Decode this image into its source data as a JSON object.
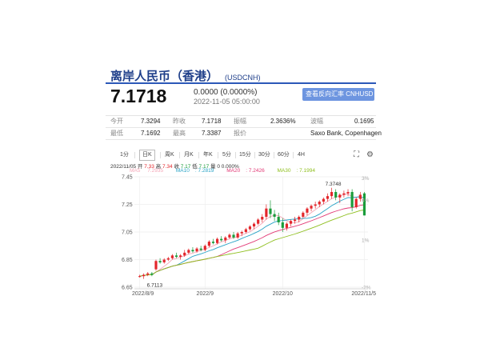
{
  "header": {
    "title": "离岸人民币（香港）",
    "code": "(USDCNH)",
    "price": "7.1718",
    "change": "0.0000 (0.0000%)",
    "timestamp": "2022-11-05 05:00:00",
    "reverse_button": "查看反向汇率 CNHUSD"
  },
  "stats": [
    [
      {
        "label": "今开",
        "value": "7.3294"
      },
      {
        "label": "昨收",
        "value": "7.1718"
      },
      {
        "label": "振幅",
        "value": "2.3636%"
      },
      {
        "label": "波幅",
        "value": "0.1695"
      }
    ],
    [
      {
        "label": "最低",
        "value": "7.1692"
      },
      {
        "label": "最高",
        "value": "7.3387"
      },
      {
        "label": "报价",
        "value": "Saxo Bank, Copenhagen"
      }
    ]
  ],
  "tabs": [
    "1分",
    "日K",
    "周K",
    "月K",
    "年K",
    "5分",
    "15分",
    "30分",
    "60分",
    "4H"
  ],
  "active_tab": "日K",
  "quote_line": {
    "date": "2022/11/05",
    "open_label": "开",
    "open": "7.33",
    "high_label": "高",
    "high": "7.34",
    "low_label": "收",
    "low": "7.17",
    "close_label": "低",
    "close": "7.17",
    "volume_label": "量",
    "volume": "0",
    "pct": "0.000%"
  },
  "ma": [
    {
      "label": "MA5",
      "value": "7.2935",
      "color": "#f5a7b8"
    },
    {
      "label": "MA10",
      "value": "7.2819",
      "color": "#29a3c6"
    },
    {
      "label": "MA20",
      "value": "7.2426",
      "color": "#e23a76"
    },
    {
      "label": "MA30",
      "value": "7.1994",
      "color": "#8fbf1f"
    }
  ],
  "colors": {
    "up": "#e3262b",
    "down": "#1a9c3b",
    "accent": "#2b58b8"
  },
  "chart_data": {
    "type": "candlestick",
    "y_ticks": [
      "7.45",
      "7.25",
      "7.05",
      "6.85",
      "6.65"
    ],
    "pct_ticks": [
      "3%",
      "4%",
      "1%",
      "-2%"
    ],
    "x_ticks": [
      "2022/8/9",
      "2022/9",
      "2022/10",
      "2022/11/5"
    ],
    "ylim": [
      6.65,
      7.45
    ],
    "annotations": {
      "max": "7.3748",
      "min": "6.7113"
    },
    "candles": [
      [
        6.73,
        6.74,
        6.72,
        6.73
      ],
      [
        6.73,
        6.75,
        6.71,
        6.74
      ],
      [
        6.74,
        6.76,
        6.73,
        6.75
      ],
      [
        6.75,
        6.76,
        6.73,
        6.74
      ],
      [
        6.78,
        6.85,
        6.77,
        6.84
      ],
      [
        6.84,
        6.86,
        6.82,
        6.83
      ],
      [
        6.83,
        6.86,
        6.82,
        6.85
      ],
      [
        6.85,
        6.87,
        6.84,
        6.86
      ],
      [
        6.86,
        6.89,
        6.85,
        6.88
      ],
      [
        6.88,
        6.9,
        6.86,
        6.87
      ],
      [
        6.87,
        6.89,
        6.85,
        6.88
      ],
      [
        6.88,
        6.92,
        6.87,
        6.9
      ],
      [
        6.9,
        6.93,
        6.89,
        6.92
      ],
      [
        6.92,
        6.94,
        6.9,
        6.91
      ],
      [
        6.91,
        6.94,
        6.9,
        6.93
      ],
      [
        6.93,
        6.95,
        6.91,
        6.92
      ],
      [
        6.92,
        6.96,
        6.91,
        6.95
      ],
      [
        6.95,
        6.99,
        6.94,
        6.98
      ],
      [
        6.98,
        7.0,
        6.96,
        6.97
      ],
      [
        6.97,
        7.01,
        6.96,
        7.0
      ],
      [
        7.0,
        7.02,
        6.98,
        6.99
      ],
      [
        6.99,
        7.02,
        6.97,
        7.01
      ],
      [
        7.01,
        7.04,
        7.0,
        7.03
      ],
      [
        7.03,
        7.05,
        7.0,
        7.01
      ],
      [
        7.01,
        7.05,
        7.0,
        7.04
      ],
      [
        7.04,
        7.06,
        7.02,
        7.05
      ],
      [
        7.05,
        7.08,
        7.04,
        7.07
      ],
      [
        7.07,
        7.1,
        7.06,
        7.09
      ],
      [
        7.09,
        7.12,
        7.07,
        7.11
      ],
      [
        7.11,
        7.15,
        7.1,
        7.14
      ],
      [
        7.14,
        7.18,
        7.12,
        7.16
      ],
      [
        7.16,
        7.25,
        7.14,
        7.22
      ],
      [
        7.22,
        7.28,
        7.15,
        7.18
      ],
      [
        7.18,
        7.21,
        7.13,
        7.16
      ],
      [
        7.16,
        7.19,
        7.1,
        7.12
      ],
      [
        7.12,
        7.15,
        7.05,
        7.08
      ],
      [
        7.08,
        7.12,
        7.06,
        7.11
      ],
      [
        7.11,
        7.14,
        7.09,
        7.13
      ],
      [
        7.13,
        7.16,
        7.11,
        7.14
      ],
      [
        7.14,
        7.17,
        7.12,
        7.16
      ],
      [
        7.16,
        7.2,
        7.15,
        7.19
      ],
      [
        7.19,
        7.23,
        7.17,
        7.22
      ],
      [
        7.22,
        7.25,
        7.2,
        7.24
      ],
      [
        7.24,
        7.27,
        7.22,
        7.25
      ],
      [
        7.25,
        7.28,
        7.23,
        7.27
      ],
      [
        7.27,
        7.3,
        7.25,
        7.29
      ],
      [
        7.29,
        7.33,
        7.27,
        7.31
      ],
      [
        7.31,
        7.37,
        7.29,
        7.34
      ],
      [
        7.34,
        7.36,
        7.28,
        7.3
      ],
      [
        7.3,
        7.33,
        7.26,
        7.32
      ],
      [
        7.32,
        7.35,
        7.3,
        7.33
      ],
      [
        7.33,
        7.36,
        7.31,
        7.34
      ],
      [
        7.34,
        7.36,
        7.2,
        7.23
      ],
      [
        7.23,
        7.3,
        7.22,
        7.29
      ],
      [
        7.29,
        7.34,
        7.27,
        7.32
      ],
      [
        7.33,
        7.34,
        7.17,
        7.17
      ]
    ]
  }
}
